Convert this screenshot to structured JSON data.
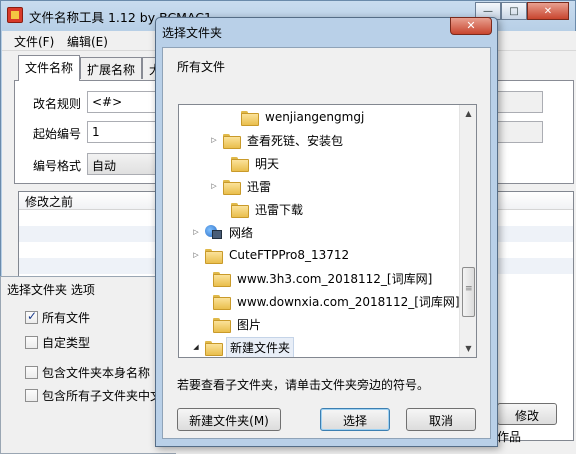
{
  "main_window": {
    "title": "文件名称工具 1.12  by BCMAC1",
    "menu": [
      "文件(F)",
      "编辑(E)"
    ],
    "tabs": [
      "文件名称",
      "扩展名称",
      "大"
    ],
    "fields": {
      "rule_label": "改名规则",
      "rule_value": "<#>",
      "start_label": "起始编号",
      "start_value": "1",
      "format_label": "编号格式",
      "format_value": "自动"
    },
    "list_header": "修改之前",
    "modify_button": "修改",
    "status_text": "作品"
  },
  "options_panel": {
    "title": "选择文件夹 选项",
    "checks": [
      {
        "label": "所有文件",
        "checked": true
      },
      {
        "label": "自定类型",
        "checked": false
      },
      {
        "label": "包含文件夹本身名称",
        "checked": false
      },
      {
        "label": "包含所有子文件夹中文",
        "checked": false
      }
    ]
  },
  "dialog": {
    "title": "选择文件夹",
    "description": "所有文件",
    "tree": [
      {
        "label": "wenjiangengmgj",
        "icon": "folder-icon",
        "expander": "none"
      },
      {
        "label": "查看死链、安装包",
        "icon": "folder-icon",
        "expander": "collapsed"
      },
      {
        "label": "明天",
        "icon": "folder-icon",
        "expander": "none"
      },
      {
        "label": "迅雷",
        "icon": "folder-icon",
        "expander": "collapsed"
      },
      {
        "label": "迅雷下载",
        "icon": "folder-icon",
        "expander": "none"
      },
      {
        "label": "网络",
        "icon": "network-icon",
        "expander": "collapsed"
      },
      {
        "label": "CuteFTPPro8_13712",
        "icon": "folder-icon",
        "expander": "collapsed"
      },
      {
        "label": "www.3h3.com_2018112_[词库网]",
        "icon": "folder-icon",
        "expander": "none"
      },
      {
        "label": "www.downxia.com_2018112_[词库网]",
        "icon": "folder-icon",
        "expander": "none"
      },
      {
        "label": "图片",
        "icon": "folder-icon",
        "expander": "none"
      },
      {
        "label": "新建文件夹",
        "icon": "folder-icon",
        "expander": "expanded",
        "selected": true
      }
    ],
    "hint": "若要查看子文件夹，请单击文件夹旁边的符号。",
    "buttons": {
      "new_folder": "新建文件夹(M)",
      "ok": "选择",
      "cancel": "取消"
    }
  }
}
